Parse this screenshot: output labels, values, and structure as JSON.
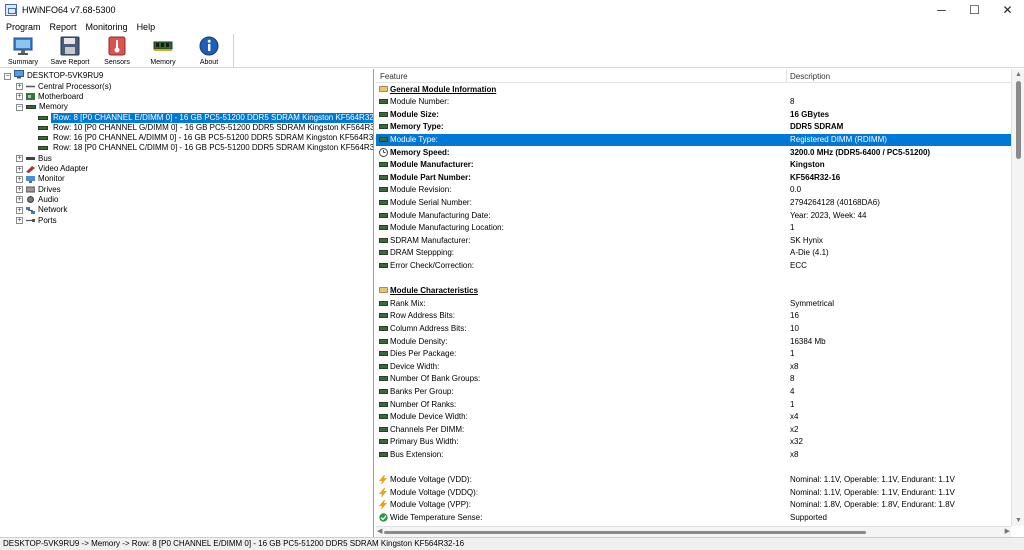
{
  "window": {
    "title": "HWiNFO64 v7.68-5300",
    "minimize": "─",
    "maximize": "☐",
    "close": "✕"
  },
  "menu": [
    "Program",
    "Report",
    "Monitoring",
    "Help"
  ],
  "toolbar": [
    {
      "label": "Summary",
      "icon": "monitor-icon"
    },
    {
      "label": "Save Report",
      "icon": "floppy-icon"
    },
    {
      "label": "Sensors",
      "icon": "thermometer-icon"
    },
    {
      "label": "Memory",
      "icon": "ram-module-icon"
    },
    {
      "label": "About",
      "icon": "info-icon"
    }
  ],
  "tree": {
    "root": "DESKTOP-5VK9RU9",
    "items": [
      {
        "label": "Central Processor(s)",
        "icon": "cpu-icon",
        "expander": "+"
      },
      {
        "label": "Motherboard",
        "icon": "motherboard-icon",
        "expander": "+"
      },
      {
        "label": "Memory",
        "icon": "ram-module-icon",
        "expander": "−"
      },
      {
        "label": "Bus",
        "icon": "bus-icon",
        "expander": "+"
      },
      {
        "label": "Video Adapter",
        "icon": "video-card-icon",
        "expander": "+"
      },
      {
        "label": "Monitor",
        "icon": "monitor-icon",
        "expander": "+"
      },
      {
        "label": "Drives",
        "icon": "drive-icon",
        "expander": "+"
      },
      {
        "label": "Audio",
        "icon": "speaker-icon",
        "expander": "+"
      },
      {
        "label": "Network",
        "icon": "network-icon",
        "expander": "+"
      },
      {
        "label": "Ports",
        "icon": "ports-icon",
        "expander": "+"
      }
    ],
    "memory_rows": [
      "Row: 8 [P0 CHANNEL E/DIMM 0] - 16 GB PC5-51200 DDR5 SDRAM Kingston KF564R32-16",
      "Row: 10 [P0 CHANNEL G/DIMM 0] - 16 GB PC5-51200 DDR5 SDRAM Kingston KF564R32-16",
      "Row: 16 [P0 CHANNEL A/DIMM 0] - 16 GB PC5-51200 DDR5 SDRAM Kingston KF564R32-16",
      "Row: 18 [P0 CHANNEL C/DIMM 0] - 16 GB PC5-51200 DDR5 SDRAM Kingston KF564R32-16"
    ]
  },
  "details": {
    "header_feature": "Feature",
    "header_description": "Description",
    "rows": [
      {
        "type": "section",
        "feature": "General Module Information",
        "desc": "",
        "icon": "folder"
      },
      {
        "feature": "Module Number:",
        "desc": "8",
        "icon": "ram"
      },
      {
        "feature": "Module Size:",
        "desc": "16 GBytes",
        "icon": "ram",
        "bold": true
      },
      {
        "feature": "Memory Type:",
        "desc": "DDR5 SDRAM",
        "icon": "ram",
        "bold": true
      },
      {
        "feature": "Module Type:",
        "desc": "Registered DIMM (RDIMM)",
        "icon": "ram",
        "selected": true
      },
      {
        "feature": "Memory Speed:",
        "desc": "3200.0 MHz (DDR5-6400 / PC5-51200)",
        "icon": "clock",
        "bold": true
      },
      {
        "feature": "Module Manufacturer:",
        "desc": "Kingston",
        "icon": "ram",
        "bold": true
      },
      {
        "feature": "Module Part Number:",
        "desc": "KF564R32-16",
        "icon": "ram",
        "bold": true
      },
      {
        "feature": "Module Revision:",
        "desc": "0.0",
        "icon": "ram"
      },
      {
        "feature": "Module Serial Number:",
        "desc": "2794264128 (40168DA6)",
        "icon": "ram"
      },
      {
        "feature": "Module Manufacturing Date:",
        "desc": "Year: 2023, Week: 44",
        "icon": "ram"
      },
      {
        "feature": "Module Manufacturing Location:",
        "desc": "1",
        "icon": "ram"
      },
      {
        "feature": "SDRAM Manufacturer:",
        "desc": "SK Hynix",
        "icon": "ram"
      },
      {
        "feature": "DRAM Steppping:",
        "desc": "A-Die (4.1)",
        "icon": "ram"
      },
      {
        "feature": "Error Check/Correction:",
        "desc": "ECC",
        "icon": "ram"
      },
      {
        "type": "blank",
        "feature": "",
        "desc": ""
      },
      {
        "type": "section",
        "feature": "Module Characteristics",
        "desc": "",
        "icon": "folder"
      },
      {
        "feature": "Rank Mix:",
        "desc": "Symmetrical",
        "icon": "ram"
      },
      {
        "feature": "Row Address Bits:",
        "desc": "16",
        "icon": "ram"
      },
      {
        "feature": "Column Address Bits:",
        "desc": "10",
        "icon": "ram"
      },
      {
        "feature": "Module Density:",
        "desc": "16384 Mb",
        "icon": "ram"
      },
      {
        "feature": "Dies Per Package:",
        "desc": "1",
        "icon": "ram"
      },
      {
        "feature": "Device Width:",
        "desc": "x8",
        "icon": "ram"
      },
      {
        "feature": "Number Of Bank Groups:",
        "desc": "8",
        "icon": "ram"
      },
      {
        "feature": "Banks Per Group:",
        "desc": "4",
        "icon": "ram"
      },
      {
        "feature": "Number Of Ranks:",
        "desc": "1",
        "icon": "ram"
      },
      {
        "feature": "Module Device Width:",
        "desc": "x4",
        "icon": "ram"
      },
      {
        "feature": "Channels Per DIMM:",
        "desc": "x2",
        "icon": "ram"
      },
      {
        "feature": "Primary Bus Width:",
        "desc": "x32",
        "icon": "ram"
      },
      {
        "feature": "Bus Extension:",
        "desc": "x8",
        "icon": "ram"
      },
      {
        "type": "blank",
        "feature": "",
        "desc": ""
      },
      {
        "feature": "Module Voltage (VDD):",
        "desc": "Nominal: 1.1V, Operable: 1.1V, Endurant: 1.1V",
        "icon": "bolt"
      },
      {
        "feature": "Module Voltage (VDDQ):",
        "desc": "Nominal: 1.1V, Operable: 1.1V, Endurant: 1.1V",
        "icon": "bolt"
      },
      {
        "feature": "Module Voltage (VPP):",
        "desc": "Nominal: 1.8V, Operable: 1.8V, Endurant: 1.8V",
        "icon": "bolt"
      },
      {
        "feature": "Wide Temperature Sense:",
        "desc": "Supported",
        "icon": "check"
      }
    ]
  },
  "statusbar": "DESKTOP-5VK9RU9 -> Memory -> Row: 8 [P0 CHANNEL E/DIMM 0] - 16 GB PC5-51200 DDR5 SDRAM Kingston KF564R32-16",
  "colors": {
    "selection": "#0078d7",
    "ram_green": "#3a6a3a"
  }
}
